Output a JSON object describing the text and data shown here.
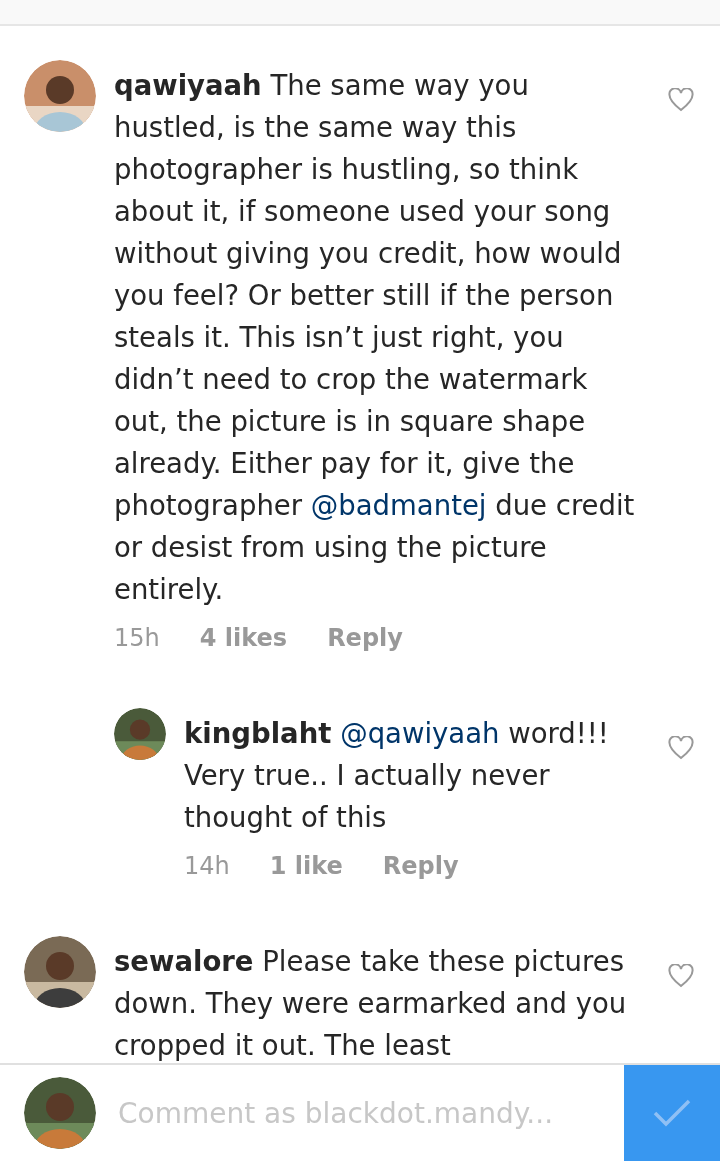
{
  "comments": [
    {
      "username": "qawiyaah",
      "liked": false,
      "segments": [
        {
          "kind": "text",
          "text": "The same way you hustled, is the same way this photographer is hustling, so think about it, if someone used your song without giving you credit, how would you feel? Or better still if the person steals it. This isn’t just right, you didn’t need to crop the watermark out, the picture is in square shape already. Either pay for it, give the photographer "
        },
        {
          "kind": "mention",
          "text": "@badmantej"
        },
        {
          "kind": "text",
          "text": " due credit or desist from using the picture entirely."
        }
      ],
      "time": "15h",
      "likes": "4 likes",
      "reply": "Reply",
      "children": [
        {
          "username": "kingblaht",
          "liked": false,
          "segments": [
            {
              "kind": "mention",
              "text": "@qawiyaah"
            },
            {
              "kind": "text",
              "text": " word!!! Very true.. I actually never thought of this"
            }
          ],
          "time": "14h",
          "likes": "1 like",
          "reply": "Reply"
        }
      ]
    },
    {
      "username": "sewalore",
      "liked": false,
      "segments": [
        {
          "kind": "text",
          "text": "Please take these pictures down. They were earmarked and you cropped it out. The least"
        }
      ]
    }
  ],
  "composer": {
    "placeholder": "Comment as blackdot.mandy..."
  }
}
